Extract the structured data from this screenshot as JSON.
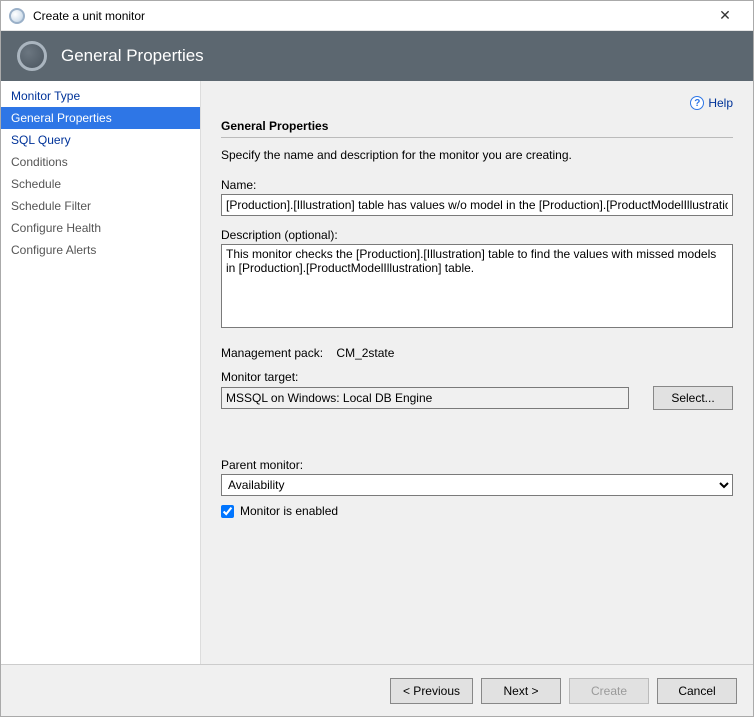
{
  "window": {
    "title": "Create a unit monitor"
  },
  "banner": {
    "title": "General Properties"
  },
  "help": {
    "label": "Help"
  },
  "nav": {
    "items": [
      {
        "label": "Monitor Type",
        "state": "link"
      },
      {
        "label": "General Properties",
        "state": "active"
      },
      {
        "label": "SQL Query",
        "state": "link"
      },
      {
        "label": "Conditions",
        "state": "disabled"
      },
      {
        "label": "Schedule",
        "state": "disabled"
      },
      {
        "label": "Schedule Filter",
        "state": "disabled"
      },
      {
        "label": "Configure Health",
        "state": "disabled"
      },
      {
        "label": "Configure Alerts",
        "state": "disabled"
      }
    ]
  },
  "form": {
    "section_title": "General Properties",
    "instruction": "Specify the name and description for the monitor you are creating.",
    "name_label": "Name:",
    "name_value": "[Production].[Illustration] table has values w/o model in the [Production].[ProductModelIllustration] table",
    "description_label": "Description (optional):",
    "description_value": "This monitor checks the [Production].[Illustration] table to find the values with missed models in [Production].[ProductModelIllustration] table.",
    "mgmt_pack_label": "Management pack:",
    "mgmt_pack_value": "CM_2state",
    "target_label": "Monitor target:",
    "target_value": "MSSQL on Windows: Local DB Engine",
    "select_btn": "Select...",
    "parent_label": "Parent monitor:",
    "parent_value": "Availability",
    "enabled_label": "Monitor is enabled"
  },
  "footer": {
    "previous": "< Previous",
    "next": "Next >",
    "create": "Create",
    "cancel": "Cancel"
  }
}
